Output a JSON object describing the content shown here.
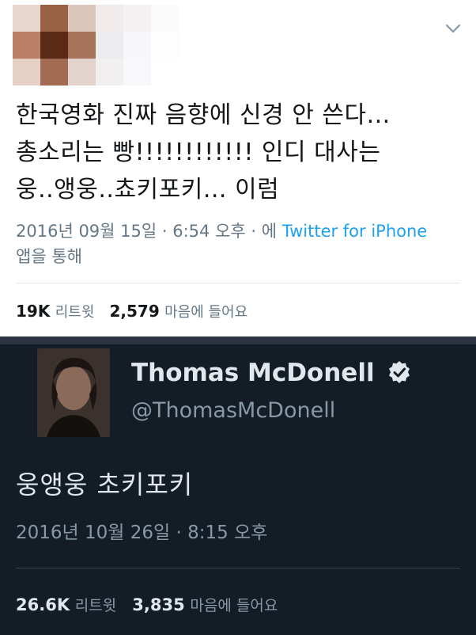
{
  "light_tweet": {
    "avatar": "blurred-avatar",
    "text_lines": [
      "한국영화 진짜 음향에 신경 안 쓴다...",
      "총소리는 빵!!!!!!!!!!!! 인디 대사는",
      "웅..앵웅..쵸키포키... 이럼"
    ],
    "timestamp": "2016년 09월 15일 · 6:54 오후 · 에",
    "source": "Twitter for iPhone",
    "via": "앱을 통해",
    "retweets_count": "19K",
    "retweets_label": "리트윗",
    "likes_count": "2,579",
    "likes_label": "마음에 들어요",
    "menu_icon": "chevron-down-icon"
  },
  "dark_tweet": {
    "name": "Thomas McDonell",
    "handle": "@ThomasMcDonell",
    "verified_icon": "verified-badge-icon",
    "text": "웅앵웅 초키포키",
    "timestamp": "2016년 10월 26일 · 8:15 오후",
    "retweets_count": "26.6K",
    "retweets_label": "리트윗",
    "likes_count": "3,835",
    "likes_label": "마음에 들어요"
  },
  "colors": {
    "light_bg": "#ffffff",
    "dark_bg": "#141d26",
    "link": "#1da1f2",
    "muted_light": "#657786",
    "muted_dark": "#8899a6"
  }
}
